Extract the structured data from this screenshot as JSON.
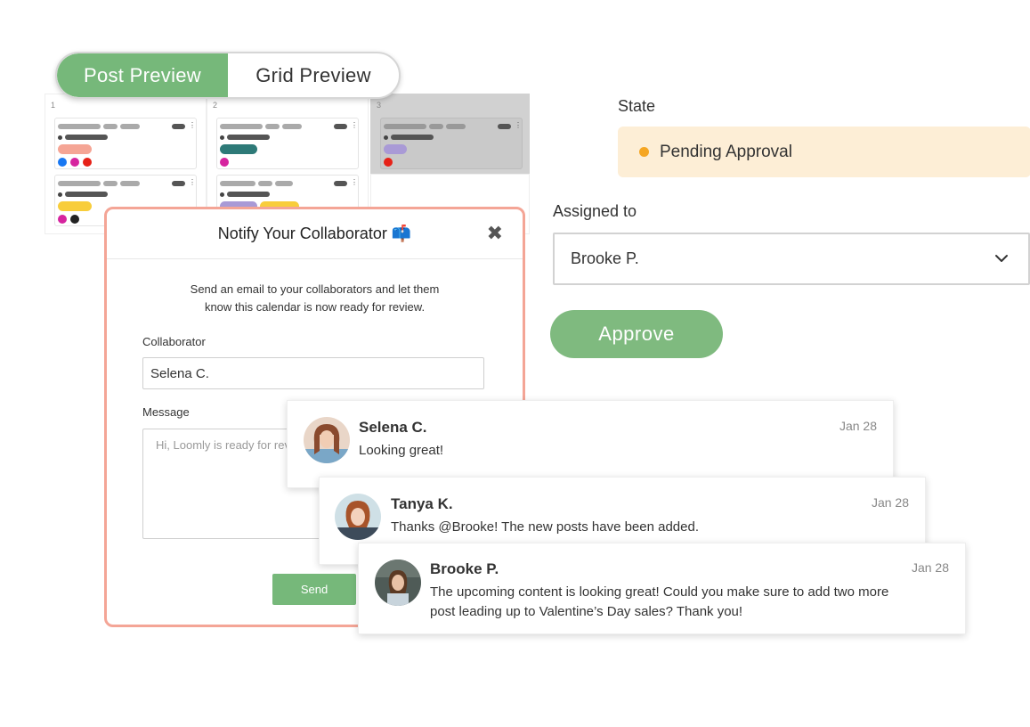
{
  "toggle": {
    "active": "Post Preview",
    "inactive": "Grid Preview"
  },
  "calendar": {
    "days": [
      "1",
      "2",
      "3"
    ],
    "colors": {
      "salmon": "#f5a595",
      "teal": "#2e7a78",
      "lavender": "#a99ad6",
      "yellow": "#f8cd3b"
    }
  },
  "dialog": {
    "title": "Notify Your Collaborator 📫",
    "intro_line1": "Send an email to your collaborators and let them",
    "intro_line2": "know this calendar is now ready for review.",
    "collaborator_label": "Collaborator",
    "collaborator_value": "Selena C.",
    "message_label": "Message",
    "message_placeholder": "Hi, Loomly is ready for rev",
    "send_label": "Send"
  },
  "state": {
    "label": "State",
    "value": "Pending Approval",
    "dot_color": "#f5a623"
  },
  "assignment": {
    "label": "Assigned to",
    "value": "Brooke P."
  },
  "approve_label": "Approve",
  "comments": [
    {
      "name": "Selena C.",
      "date": "Jan 28",
      "text": "Looking great!"
    },
    {
      "name": "Tanya K.",
      "date": "Jan 28",
      "text": "Thanks @Brooke! The new posts have been added."
    },
    {
      "name": "Brooke P.",
      "date": "Jan 28",
      "text_line1": "The upcoming content is looking great! Could you make sure to add two more",
      "text_line2": "post leading up to Valentine’s Day sales? Thank you!"
    }
  ],
  "colors": {
    "accent_green": "#76b87a",
    "dialog_border": "#f4a596",
    "state_bg": "#fdeed6"
  }
}
